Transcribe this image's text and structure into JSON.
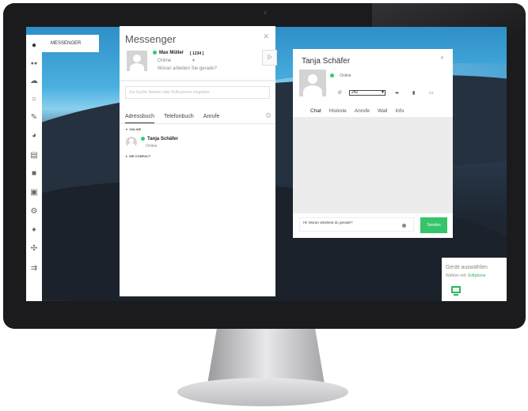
{
  "sidebar": {
    "icons": [
      "user-icon",
      "group-icon",
      "cloud-icon",
      "headset-icon",
      "edit-icon",
      "dashboard-icon",
      "document-icon",
      "book-icon",
      "lock-icon",
      "settings-icon",
      "tools-icon",
      "network-icon",
      "logout-icon"
    ],
    "messenger_tab": "MESSENGER"
  },
  "messenger": {
    "title": "Messenger",
    "user_name": "Max Müller",
    "extension": "[ 1234 ]",
    "status": "Online",
    "mood_placeholder": "Woran arbeiten Sie gerade?",
    "search_placeholder": "Zur Suche Namen oder Rufnummer eingeben.",
    "tabs": [
      "Adressbuch",
      "Telefonbuch",
      "Anrufe"
    ],
    "groups": [
      "ONLINE",
      "MR COMPACT"
    ],
    "contact": {
      "name": "Tanja Schäfer",
      "status": "Online"
    }
  },
  "chat": {
    "title": "Tanja Schäfer",
    "status": "Online",
    "phone_select": "242",
    "tabs": [
      "Chat",
      "Historie",
      "Anrufe",
      "Wall",
      "Info"
    ],
    "input_value": "Hi! Woran arbeitest du gerade?",
    "send_label": "Senden"
  },
  "device_chooser": {
    "title": "Gerät auswählen",
    "prefix": "Wählen mit:",
    "selected": "Softphone"
  },
  "colors": {
    "accent_green": "#35c46a",
    "online_dot": "#2ecc71"
  }
}
